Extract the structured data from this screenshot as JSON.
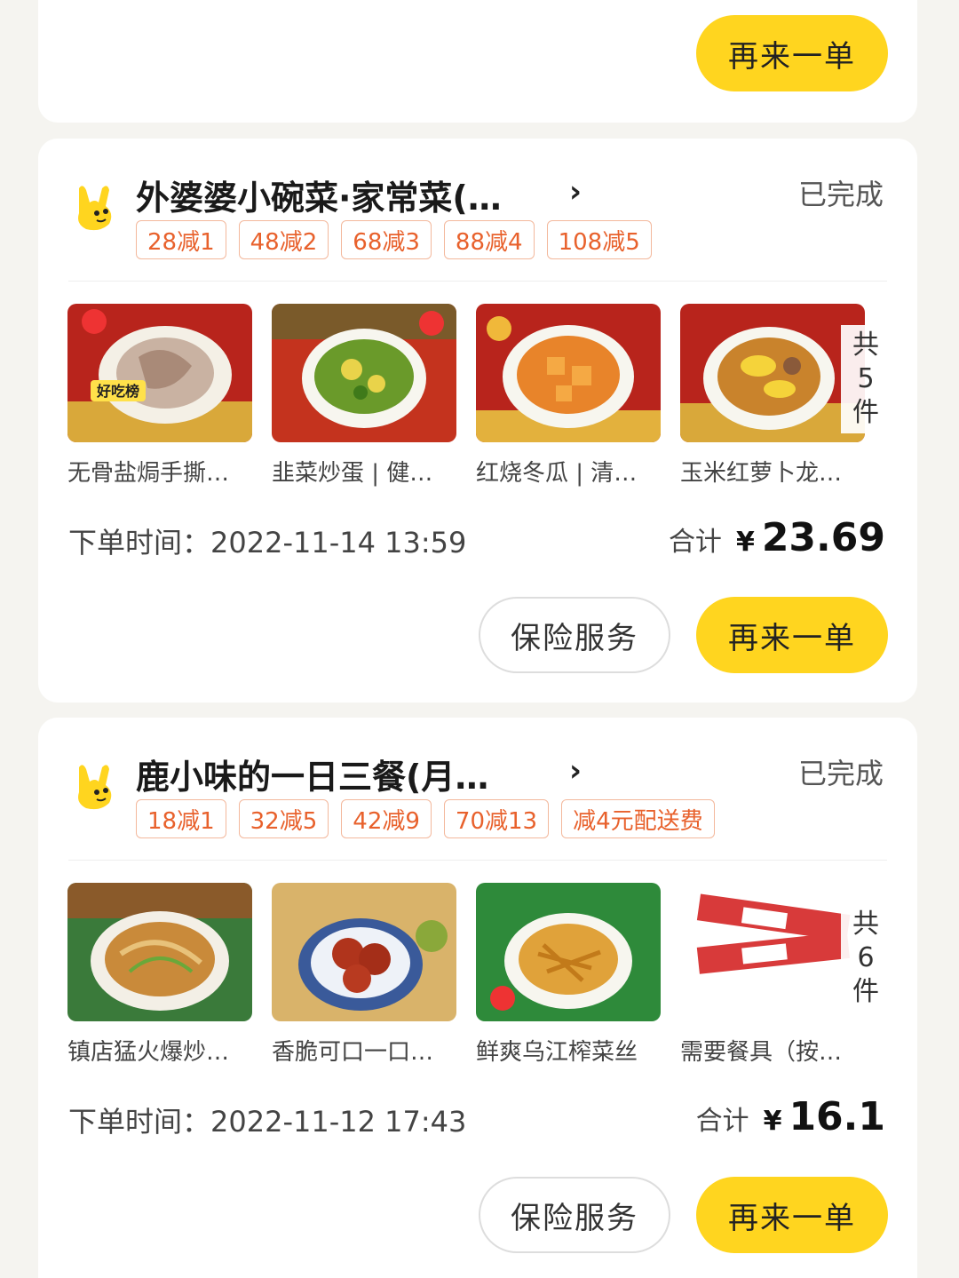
{
  "top_card": {
    "reorder_label": "再来一单"
  },
  "orders": [
    {
      "shop_name": "外婆婆小碗菜·家常菜(…",
      "status": "已完成",
      "tags": [
        "28减1",
        "48减2",
        "68减3",
        "88减4",
        "108减5"
      ],
      "items": [
        {
          "name": "无骨盐焗手撕…",
          "badge": "好吃榜",
          "theme": "red"
        },
        {
          "name": "韭菜炒蛋 | 健…",
          "badge": "",
          "theme": "green"
        },
        {
          "name": "红烧冬瓜 | 清…",
          "badge": "",
          "theme": "orange"
        },
        {
          "name": "玉米红萝卜龙…",
          "badge": "",
          "theme": "soup"
        }
      ],
      "count": {
        "prefix": "共",
        "num": "5",
        "suffix": "件"
      },
      "order_time_label": "下单时间：",
      "order_time": "2022-11-14 13:59",
      "total_label": "合计",
      "currency": "¥",
      "total": "23.69",
      "insurance_label": "保险服务",
      "reorder_label": "再来一单"
    },
    {
      "shop_name": "鹿小味的一日三餐(月…",
      "status": "已完成",
      "tags": [
        "18减1",
        "32减5",
        "42减9",
        "70减13",
        "减4元配送费"
      ],
      "items": [
        {
          "name": "镇店猛火爆炒…",
          "badge": "",
          "theme": "noodle"
        },
        {
          "name": "香脆可口一口…",
          "badge": "",
          "theme": "ball"
        },
        {
          "name": "鲜爽乌江榨菜丝",
          "badge": "",
          "theme": "pickle"
        },
        {
          "name": "需要餐具（按…",
          "badge": "",
          "theme": "cutlery"
        }
      ],
      "count": {
        "prefix": "共",
        "num": "6",
        "suffix": "件"
      },
      "order_time_label": "下单时间：",
      "order_time": "2022-11-12 17:43",
      "total_label": "合计",
      "currency": "¥",
      "total": "16.1",
      "insurance_label": "保险服务",
      "reorder_label": "再来一单"
    }
  ],
  "colors": {
    "accent_yellow": "#ffd51f",
    "tag_orange": "#e8612c"
  }
}
